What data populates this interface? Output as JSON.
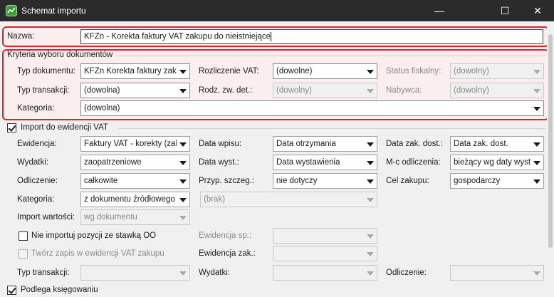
{
  "window": {
    "title": "Schemat importu",
    "minimize_glyph": "—",
    "maximize_glyph": "☐",
    "close_glyph": "✕",
    "icon": "app-icon"
  },
  "nazwa": {
    "label": "Nazwa:",
    "value": "KFZn - Korekta faktury VAT zakupu do nieistniejące"
  },
  "kryteria": {
    "title": "Kryteria wyboru dokumentów",
    "typ_dokumentu": {
      "label": "Typ dokumentu:",
      "value": "KFZn Korekta faktury zakup"
    },
    "rozliczenie_vat": {
      "label": "Rozliczenie VAT:",
      "value": "(dowolne)"
    },
    "status_fiskalny": {
      "label": "Status fiskalny:",
      "value": "(dowolny)"
    },
    "typ_transakcji": {
      "label": "Typ transakcji:",
      "value": "(dowolna)"
    },
    "rodz_zw_det": {
      "label": "Rodz. zw. det.:",
      "value": "(dowolny)"
    },
    "nabywca": {
      "label": "Nabywca:",
      "value": "(dowolny)"
    },
    "kategoria": {
      "label": "Kategoria:",
      "value": "(dowolna)"
    }
  },
  "import_vat": {
    "checkbox_label": "Import do ewidencji VAT",
    "checked": true,
    "ewidencja": {
      "label": "Ewidencja:",
      "value": "Faktury VAT - korekty (zaku"
    },
    "data_wpisu": {
      "label": "Data wpisu:",
      "value": "Data otrzymania"
    },
    "data_zak_dost": {
      "label": "Data zak. dost.:",
      "value": "Data zak. dost."
    },
    "wydatki": {
      "label": "Wydatki:",
      "value": "zaopatrzeniowe"
    },
    "data_wyst": {
      "label": "Data wyst.:",
      "value": "Data wystawienia"
    },
    "mc_odliczenia": {
      "label": "M-c odliczenia:",
      "value": "bieżący wg daty wystaw"
    },
    "odliczenie": {
      "label": "Odliczenie:",
      "value": "całkowite"
    },
    "przyp_szczeg": {
      "label": "Przyp. szczeg.:",
      "value": "nie dotyczy"
    },
    "cel_zakupu": {
      "label": "Cel zakupu:",
      "value": "gospodarczy"
    },
    "kategoria": {
      "label": "Kategoria:",
      "value": "z dokumentu źródłowego"
    },
    "kategoria_2": {
      "value": "(brak)"
    },
    "import_wartosci": {
      "label": "Import wartości:",
      "value": "wg dokumentu"
    },
    "nie_importuj": {
      "label": "Nie importuj pozycji ze stawką OO",
      "checked": false
    },
    "ewidencja_sp": {
      "label": "Ewidencja sp.:",
      "value": ""
    },
    "tworz_zapis": {
      "label": "Twórz zapis w ewidencji VAT zakupu",
      "checked": false
    },
    "ewidencja_zak": {
      "label": "Ewidencja zak.:",
      "value": ""
    },
    "typ_transakcji": {
      "label": "Typ transakcji:",
      "value": ""
    },
    "wydatki_2": {
      "label": "Wydatki:",
      "value": ""
    },
    "odliczenie_2": {
      "label": "Odliczenie:",
      "value": ""
    }
  },
  "podlega": {
    "label": "Podlega księgowaniu",
    "checked": true
  },
  "colors": {
    "highlight": "#e0212b",
    "titlebar": "#2b2b2b"
  }
}
